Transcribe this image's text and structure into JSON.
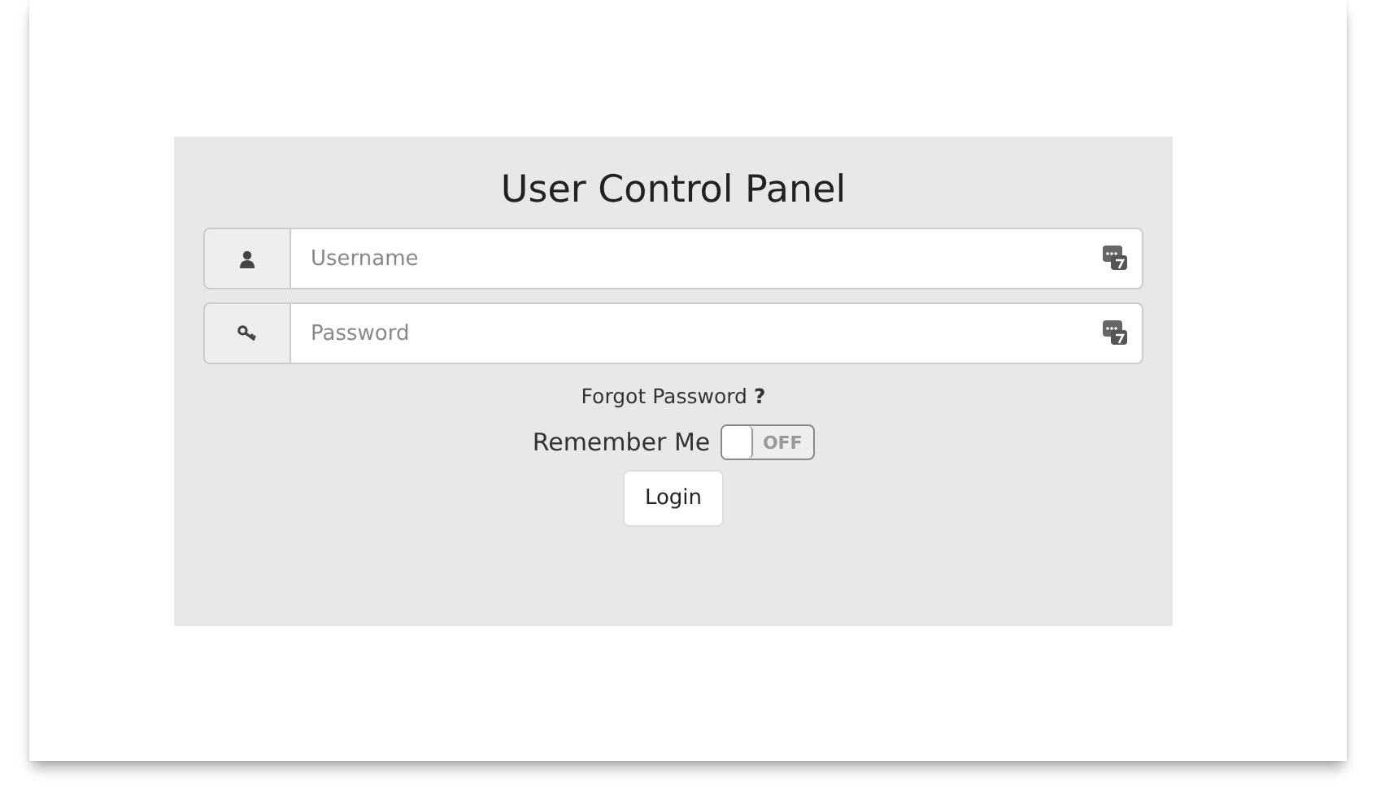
{
  "panel": {
    "title": "User Control Panel",
    "fields": [
      {
        "kind": "user",
        "placeholder": "Username"
      },
      {
        "kind": "key",
        "placeholder": "Password"
      }
    ],
    "forgot_link": "Forgot Password **?**",
    "remember": {
      "label": "Remember Me",
      "on": false,
      "state_text": "OFF"
    },
    "login_button": "Login"
  }
}
